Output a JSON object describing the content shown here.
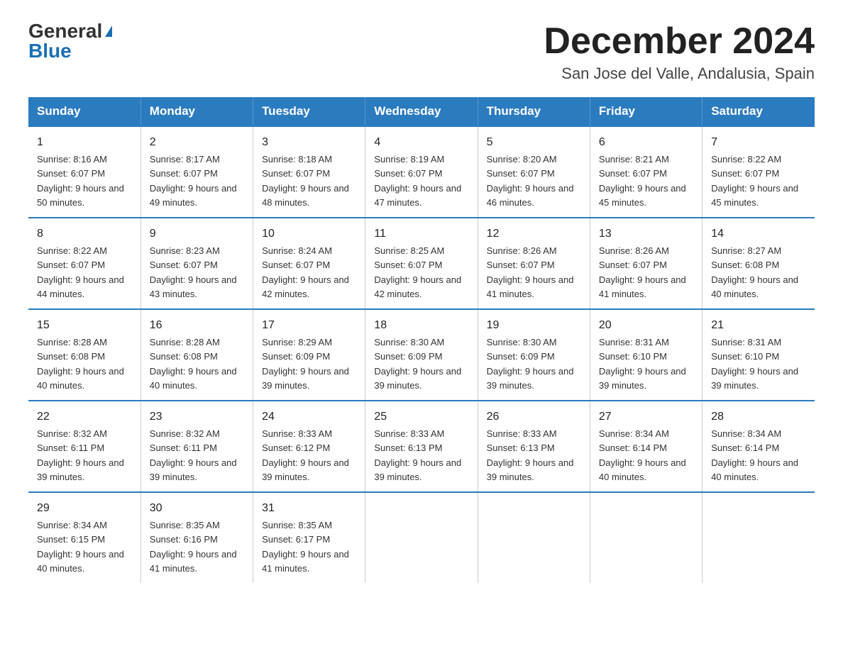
{
  "header": {
    "logo_general": "General",
    "logo_blue": "Blue",
    "month_title": "December 2024",
    "location": "San Jose del Valle, Andalusia, Spain"
  },
  "days_of_week": [
    "Sunday",
    "Monday",
    "Tuesday",
    "Wednesday",
    "Thursday",
    "Friday",
    "Saturday"
  ],
  "weeks": [
    [
      {
        "day": "1",
        "sunrise": "8:16 AM",
        "sunset": "6:07 PM",
        "daylight": "9 hours and 50 minutes."
      },
      {
        "day": "2",
        "sunrise": "8:17 AM",
        "sunset": "6:07 PM",
        "daylight": "9 hours and 49 minutes."
      },
      {
        "day": "3",
        "sunrise": "8:18 AM",
        "sunset": "6:07 PM",
        "daylight": "9 hours and 48 minutes."
      },
      {
        "day": "4",
        "sunrise": "8:19 AM",
        "sunset": "6:07 PM",
        "daylight": "9 hours and 47 minutes."
      },
      {
        "day": "5",
        "sunrise": "8:20 AM",
        "sunset": "6:07 PM",
        "daylight": "9 hours and 46 minutes."
      },
      {
        "day": "6",
        "sunrise": "8:21 AM",
        "sunset": "6:07 PM",
        "daylight": "9 hours and 45 minutes."
      },
      {
        "day": "7",
        "sunrise": "8:22 AM",
        "sunset": "6:07 PM",
        "daylight": "9 hours and 45 minutes."
      }
    ],
    [
      {
        "day": "8",
        "sunrise": "8:22 AM",
        "sunset": "6:07 PM",
        "daylight": "9 hours and 44 minutes."
      },
      {
        "day": "9",
        "sunrise": "8:23 AM",
        "sunset": "6:07 PM",
        "daylight": "9 hours and 43 minutes."
      },
      {
        "day": "10",
        "sunrise": "8:24 AM",
        "sunset": "6:07 PM",
        "daylight": "9 hours and 42 minutes."
      },
      {
        "day": "11",
        "sunrise": "8:25 AM",
        "sunset": "6:07 PM",
        "daylight": "9 hours and 42 minutes."
      },
      {
        "day": "12",
        "sunrise": "8:26 AM",
        "sunset": "6:07 PM",
        "daylight": "9 hours and 41 minutes."
      },
      {
        "day": "13",
        "sunrise": "8:26 AM",
        "sunset": "6:07 PM",
        "daylight": "9 hours and 41 minutes."
      },
      {
        "day": "14",
        "sunrise": "8:27 AM",
        "sunset": "6:08 PM",
        "daylight": "9 hours and 40 minutes."
      }
    ],
    [
      {
        "day": "15",
        "sunrise": "8:28 AM",
        "sunset": "6:08 PM",
        "daylight": "9 hours and 40 minutes."
      },
      {
        "day": "16",
        "sunrise": "8:28 AM",
        "sunset": "6:08 PM",
        "daylight": "9 hours and 40 minutes."
      },
      {
        "day": "17",
        "sunrise": "8:29 AM",
        "sunset": "6:09 PM",
        "daylight": "9 hours and 39 minutes."
      },
      {
        "day": "18",
        "sunrise": "8:30 AM",
        "sunset": "6:09 PM",
        "daylight": "9 hours and 39 minutes."
      },
      {
        "day": "19",
        "sunrise": "8:30 AM",
        "sunset": "6:09 PM",
        "daylight": "9 hours and 39 minutes."
      },
      {
        "day": "20",
        "sunrise": "8:31 AM",
        "sunset": "6:10 PM",
        "daylight": "9 hours and 39 minutes."
      },
      {
        "day": "21",
        "sunrise": "8:31 AM",
        "sunset": "6:10 PM",
        "daylight": "9 hours and 39 minutes."
      }
    ],
    [
      {
        "day": "22",
        "sunrise": "8:32 AM",
        "sunset": "6:11 PM",
        "daylight": "9 hours and 39 minutes."
      },
      {
        "day": "23",
        "sunrise": "8:32 AM",
        "sunset": "6:11 PM",
        "daylight": "9 hours and 39 minutes."
      },
      {
        "day": "24",
        "sunrise": "8:33 AM",
        "sunset": "6:12 PM",
        "daylight": "9 hours and 39 minutes."
      },
      {
        "day": "25",
        "sunrise": "8:33 AM",
        "sunset": "6:13 PM",
        "daylight": "9 hours and 39 minutes."
      },
      {
        "day": "26",
        "sunrise": "8:33 AM",
        "sunset": "6:13 PM",
        "daylight": "9 hours and 39 minutes."
      },
      {
        "day": "27",
        "sunrise": "8:34 AM",
        "sunset": "6:14 PM",
        "daylight": "9 hours and 40 minutes."
      },
      {
        "day": "28",
        "sunrise": "8:34 AM",
        "sunset": "6:14 PM",
        "daylight": "9 hours and 40 minutes."
      }
    ],
    [
      {
        "day": "29",
        "sunrise": "8:34 AM",
        "sunset": "6:15 PM",
        "daylight": "9 hours and 40 minutes."
      },
      {
        "day": "30",
        "sunrise": "8:35 AM",
        "sunset": "6:16 PM",
        "daylight": "9 hours and 41 minutes."
      },
      {
        "day": "31",
        "sunrise": "8:35 AM",
        "sunset": "6:17 PM",
        "daylight": "9 hours and 41 minutes."
      },
      null,
      null,
      null,
      null
    ]
  ]
}
